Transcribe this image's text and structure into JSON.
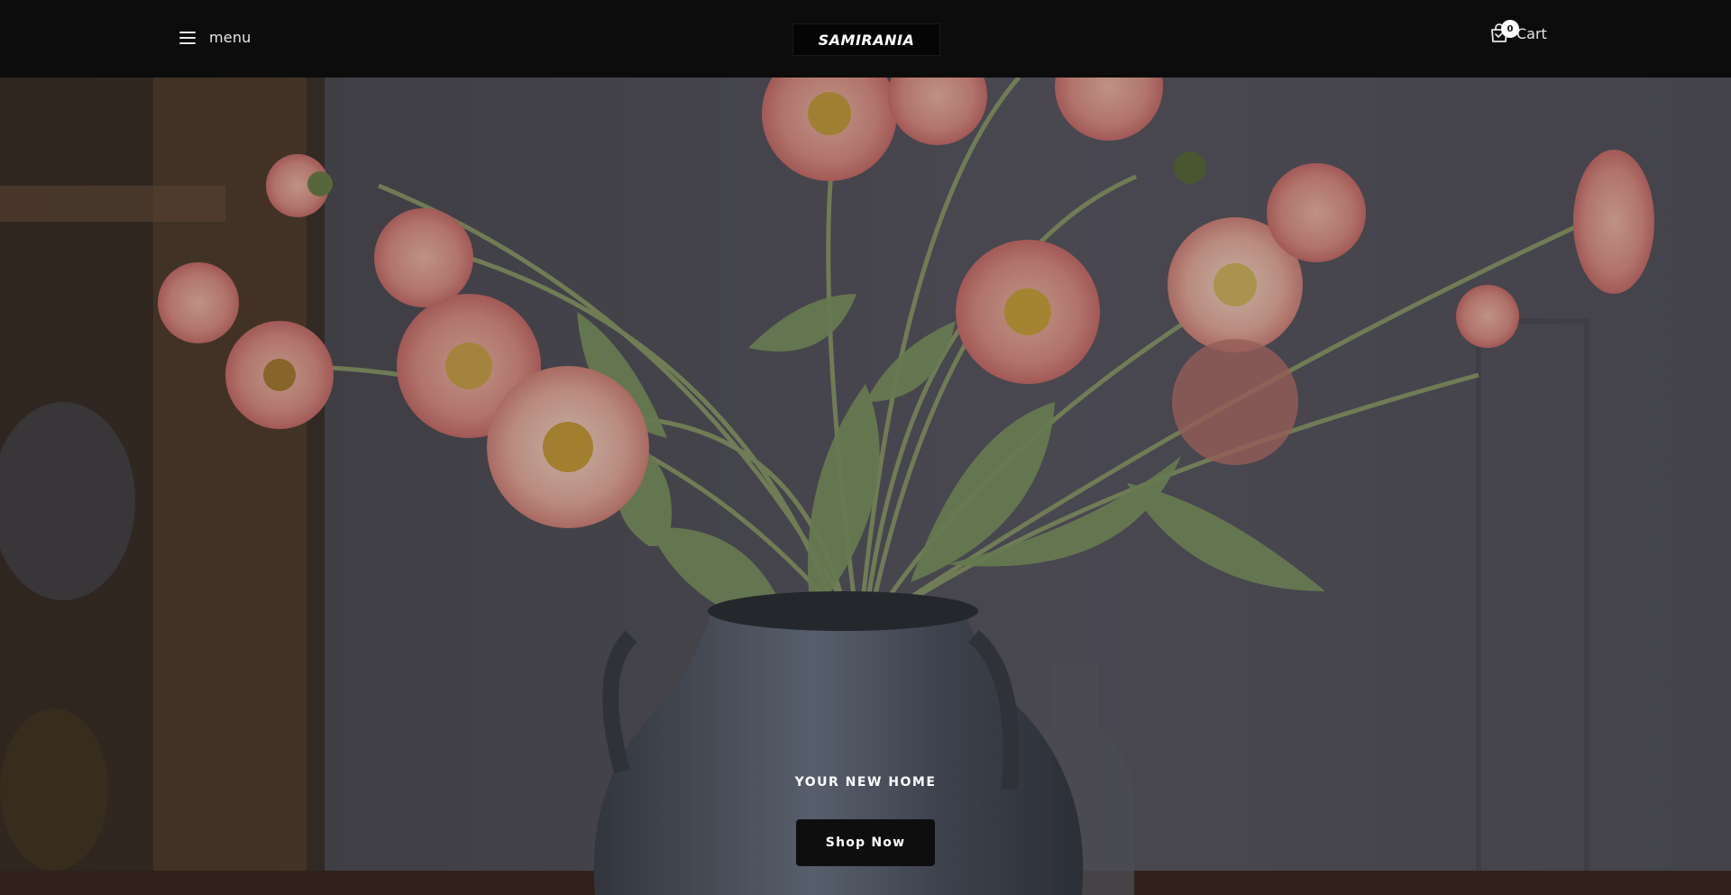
{
  "header": {
    "menu_label": "menu",
    "logo_text": "SAMIRANIA",
    "cart_label": "Cart",
    "cart_count": "0"
  },
  "hero": {
    "subtitle": "YOUR NEW HOME",
    "cta_label": "Shop Now"
  },
  "colors": {
    "header_bg": "#0c0c0c",
    "button_bg": "#0e0e0e",
    "text_light": "#e8e8e8"
  },
  "icons": {
    "menu": "hamburger-icon",
    "cart": "shopping-bag-icon"
  }
}
